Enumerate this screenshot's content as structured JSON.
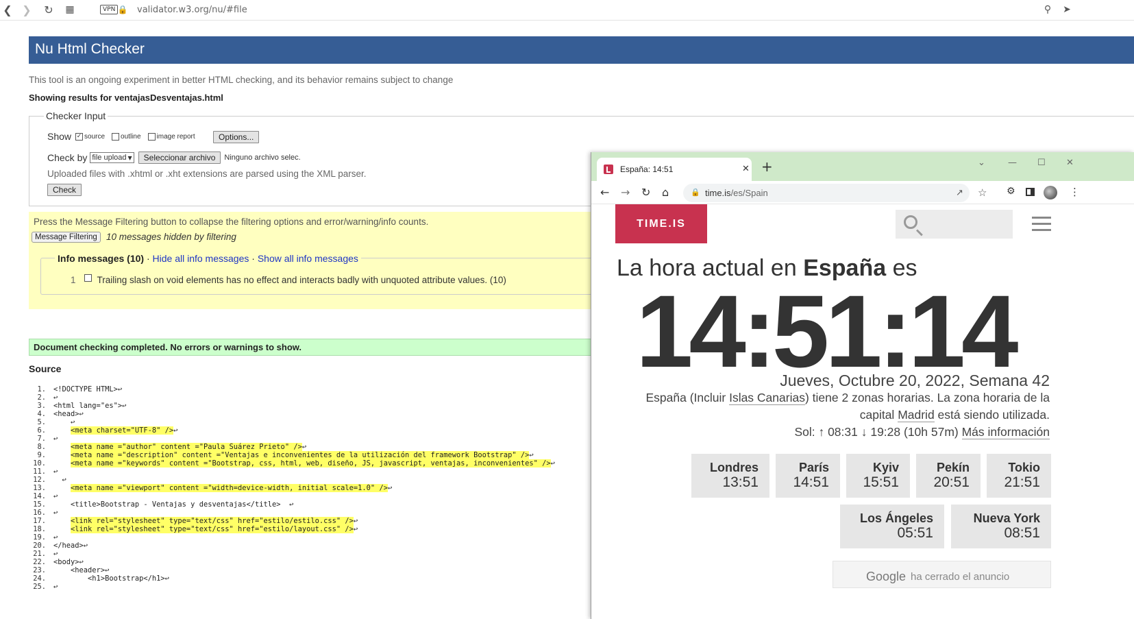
{
  "main_browser": {
    "url": "validator.w3.org/nu/#file",
    "vpn_label": "VPN"
  },
  "validator": {
    "title": "Nu Html Checker",
    "subtitle": "This tool is an ongoing experiment in better HTML checking, and its behavior remains subject to change",
    "results_for": "Showing results for ventajasDesventajas.html",
    "checker_input": {
      "legend": "Checker Input",
      "show_label": "Show",
      "checkboxes": [
        {
          "label": "source",
          "checked": true
        },
        {
          "label": "outline",
          "checked": false
        },
        {
          "label": "image report",
          "checked": false
        }
      ],
      "options_button": "Options...",
      "check_by_label": "Check by",
      "check_by_value": "file upload",
      "select_file_button": "Seleccionar archivo",
      "no_file_text": "Ninguno archivo selec.",
      "xml_note": "Uploaded files with .xhtml or .xht extensions are parsed using the XML parser.",
      "check_button": "Check"
    },
    "filtering": {
      "note": "Press the Message Filtering button to collapse the filtering options and error/warning/info counts.",
      "button": "Message Filtering",
      "hidden_note": "10 messages hidden by filtering",
      "info_legend": "Info messages (10)",
      "hide_link": "Hide all info messages",
      "show_link": "Show all info messages",
      "separator": "·",
      "items": [
        {
          "number": "1",
          "text": "Trailing slash on void elements has no effect and interacts badly with unquoted attribute values. (10)"
        }
      ]
    },
    "status": "Document checking completed. No errors or warnings to show.",
    "source_heading": "Source",
    "source_lines": [
      {
        "n": "1.",
        "code": "<!DOCTYPE HTML>↩",
        "hl": false
      },
      {
        "n": "2.",
        "code": "↩",
        "hl": false
      },
      {
        "n": "3.",
        "code": "<html lang=\"es\">↩",
        "hl": false
      },
      {
        "n": "4.",
        "code": "<head>↩",
        "hl": false
      },
      {
        "n": "5.",
        "code": "    ↩",
        "hl": false
      },
      {
        "n": "6.",
        "code": "    ",
        "hlcode": "<meta charset=\"UTF-8\" />",
        "tail": "↩",
        "hl": true
      },
      {
        "n": "7.",
        "code": "↩",
        "hl": false
      },
      {
        "n": "8.",
        "code": "    ",
        "hlcode": "<meta name =\"author\" content =\"Paula Suárez Prieto\" />",
        "tail": "↩",
        "hl": true
      },
      {
        "n": "9.",
        "code": "    ",
        "hlcode": "<meta name =\"description\" content =\"Ventajas e inconvenientes de la utilización del framework Bootstrap\" />",
        "tail": "↩",
        "hl": true
      },
      {
        "n": "10.",
        "code": "    ",
        "hlcode": "<meta name =\"keywords\" content =\"Bootstrap, css, html, web, diseño, JS, javascript, ventajas, inconvenientes\" />",
        "tail": "↩",
        "hl": true
      },
      {
        "n": "11.",
        "code": "↩",
        "hl": false
      },
      {
        "n": "12.",
        "code": "  ↩",
        "hl": false
      },
      {
        "n": "13.",
        "code": "    ",
        "hlcode": "<meta name =\"viewport\" content =\"width=device-width, initial scale=1.0\" />",
        "tail": "↩",
        "hl": true
      },
      {
        "n": "14.",
        "code": "↩",
        "hl": false
      },
      {
        "n": "15.",
        "code": "    <title>Bootstrap - Ventajas y desventajas</title>  ↩",
        "hl": false
      },
      {
        "n": "16.",
        "code": "↩",
        "hl": false
      },
      {
        "n": "17.",
        "code": "    ",
        "hlcode": "<link rel=\"stylesheet\" type=\"text/css\" href=\"estilo/estilo.css\" />",
        "tail": "↩",
        "hl": true
      },
      {
        "n": "18.",
        "code": "    ",
        "hlcode": "<link rel=\"stylesheet\" type=\"text/css\" href=\"estilo/layout.css\" />",
        "tail": "↩",
        "hl": true
      },
      {
        "n": "19.",
        "code": "↩",
        "hl": false
      },
      {
        "n": "20.",
        "code": "</head>↩",
        "hl": false
      },
      {
        "n": "21.",
        "code": "↩",
        "hl": false
      },
      {
        "n": "22.",
        "code": "<body>↩",
        "hl": false
      },
      {
        "n": "23.",
        "code": "    <header>↩",
        "hl": false
      },
      {
        "n": "24.",
        "code": "        <h1>Bootstrap</h1>↩",
        "hl": false
      },
      {
        "n": "25.",
        "code": "↩",
        "hl": false
      }
    ]
  },
  "popup_window": {
    "tab_title": "España: 14:51",
    "url_host": "time.is",
    "url_path": "/es/Spain",
    "logo": "TIME.IS",
    "headline_pre": "La hora actual en ",
    "headline_bold": "España",
    "headline_post": " es",
    "clock": "14:51:14",
    "date_line": "Jueves, Octubre 20, 2022, Semana 42",
    "tz_line1_a": "España (Incluir ",
    "tz_line1_link": "Islas Canarias",
    "tz_line1_b": ") tiene 2 zonas horarias. La zona horaria de la",
    "tz_line2_a": "capital ",
    "tz_line2_link": "Madrid",
    "tz_line2_b": " está siendo utilizada.",
    "sun_text": "Sol: ↑ 08:31 ↓ 19:28 (10h 57m) ",
    "sun_link": "Más información",
    "cities": [
      {
        "name": "Londres",
        "time": "13:51"
      },
      {
        "name": "París",
        "time": "14:51"
      },
      {
        "name": "Kyiv",
        "time": "15:51"
      },
      {
        "name": "Pekín",
        "time": "20:51"
      },
      {
        "name": "Tokio",
        "time": "21:51"
      },
      {
        "name": "Los Ángeles",
        "time": "05:51"
      },
      {
        "name": "Nueva York",
        "time": "08:51"
      }
    ],
    "ad_google": "Google",
    "ad_text": "ha cerrado el anuncio"
  }
}
